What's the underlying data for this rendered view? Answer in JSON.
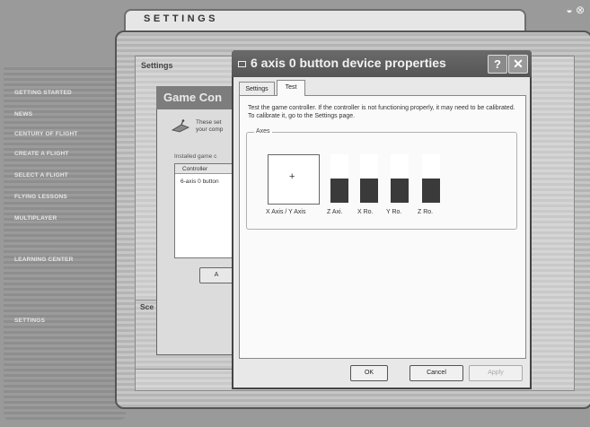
{
  "window": {
    "controls": "◒ ⊗"
  },
  "nav": {
    "items": [
      "GETTING STARTED",
      "NEWS",
      "CENTURY OF FLIGHT",
      "CREATE A FLIGHT",
      "SELECT A FLIGHT",
      "FLYING LESSONS",
      "MULTIPLAYER",
      "LEARNING CENTER",
      "SETTINGS"
    ]
  },
  "settings": {
    "title": "SETTINGS",
    "section_label": "Settings",
    "scenery_label": "Sce"
  },
  "game_controllers": {
    "title": "Game Con",
    "description": "These set your comp",
    "installed_label": "Installed game c",
    "list_header": "Controller",
    "list_row": "6-axis 0 button",
    "add_button": "A"
  },
  "properties": {
    "title": "6 axis 0 button device properties",
    "help": "?",
    "close": "✕",
    "tabs": [
      "Settings",
      "Test"
    ],
    "description": "Test the game controller. If the controller is not functioning properly, it may need to be calibrated. To calibrate it, go to the Settings page.",
    "axes_group": "Axes",
    "xy_label": "X Axis / Y Axis",
    "xy_marker": "+",
    "axes": [
      {
        "label": "Z Axi.",
        "value": 0.5
      },
      {
        "label": "X Ro.",
        "value": 0.5
      },
      {
        "label": "Y Ro.",
        "value": 0.5
      },
      {
        "label": "Z Ro.",
        "value": 0.5
      }
    ],
    "buttons": {
      "ok": "OK",
      "cancel": "Cancel",
      "apply": "Apply"
    }
  }
}
